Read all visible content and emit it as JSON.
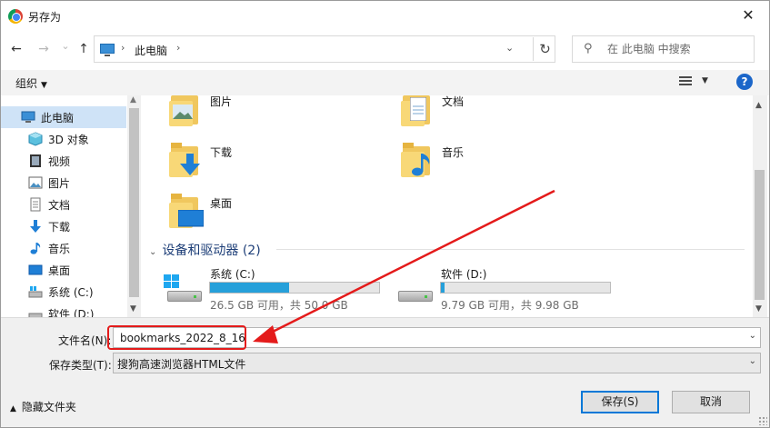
{
  "window": {
    "title": "另存为"
  },
  "nav": {
    "back": "←",
    "forward": "→",
    "recent": "⌄",
    "up": "↑",
    "breadcrumb": "此电脑",
    "search_placeholder": "在 此电脑 中搜索"
  },
  "toolbar": {
    "organize": "组织"
  },
  "sidebar": {
    "items": [
      {
        "label": "此电脑",
        "icon": "computer-icon"
      },
      {
        "label": "3D 对象",
        "icon": "cube-3d-icon"
      },
      {
        "label": "视频",
        "icon": "video-icon"
      },
      {
        "label": "图片",
        "icon": "pictures-icon"
      },
      {
        "label": "文档",
        "icon": "documents-icon"
      },
      {
        "label": "下载",
        "icon": "download-icon"
      },
      {
        "label": "音乐",
        "icon": "music-icon"
      },
      {
        "label": "桌面",
        "icon": "desktop-icon"
      },
      {
        "label": "系统 (C:)",
        "icon": "drive-icon"
      },
      {
        "label": "软件 (D:)",
        "icon": "drive-icon"
      }
    ]
  },
  "content": {
    "folders": [
      {
        "label": "图片",
        "icon": "pictures-folder-icon"
      },
      {
        "label": "文档",
        "icon": "documents-folder-icon"
      },
      {
        "label": "下载",
        "icon": "downloads-folder-icon"
      },
      {
        "label": "音乐",
        "icon": "music-folder-icon"
      },
      {
        "label": "桌面",
        "icon": "desktop-folder-icon"
      }
    ],
    "devices_heading": "设备和驱动器 (2)",
    "drives": [
      {
        "label": "系统 (C:)",
        "size": "26.5 GB 可用，共 50.0 GB",
        "used_fraction": 0.47
      },
      {
        "label": "软件 (D:)",
        "size": "9.79 GB 可用，共 9.98 GB",
        "used_fraction": 0.02
      }
    ]
  },
  "form": {
    "filename_label": "文件名(N):",
    "filename_value": "bookmarks_2022_8_16",
    "filetype_label": "保存类型(T):",
    "filetype_value": "搜狗高速浏览器HTML文件"
  },
  "footer": {
    "hide_folders": "隐藏文件夹",
    "save": "保存(S)",
    "cancel": "取消"
  },
  "colors": {
    "accent": "#0078d7",
    "annotation": "#e41b1b",
    "drive_bar": "#26a0da"
  }
}
